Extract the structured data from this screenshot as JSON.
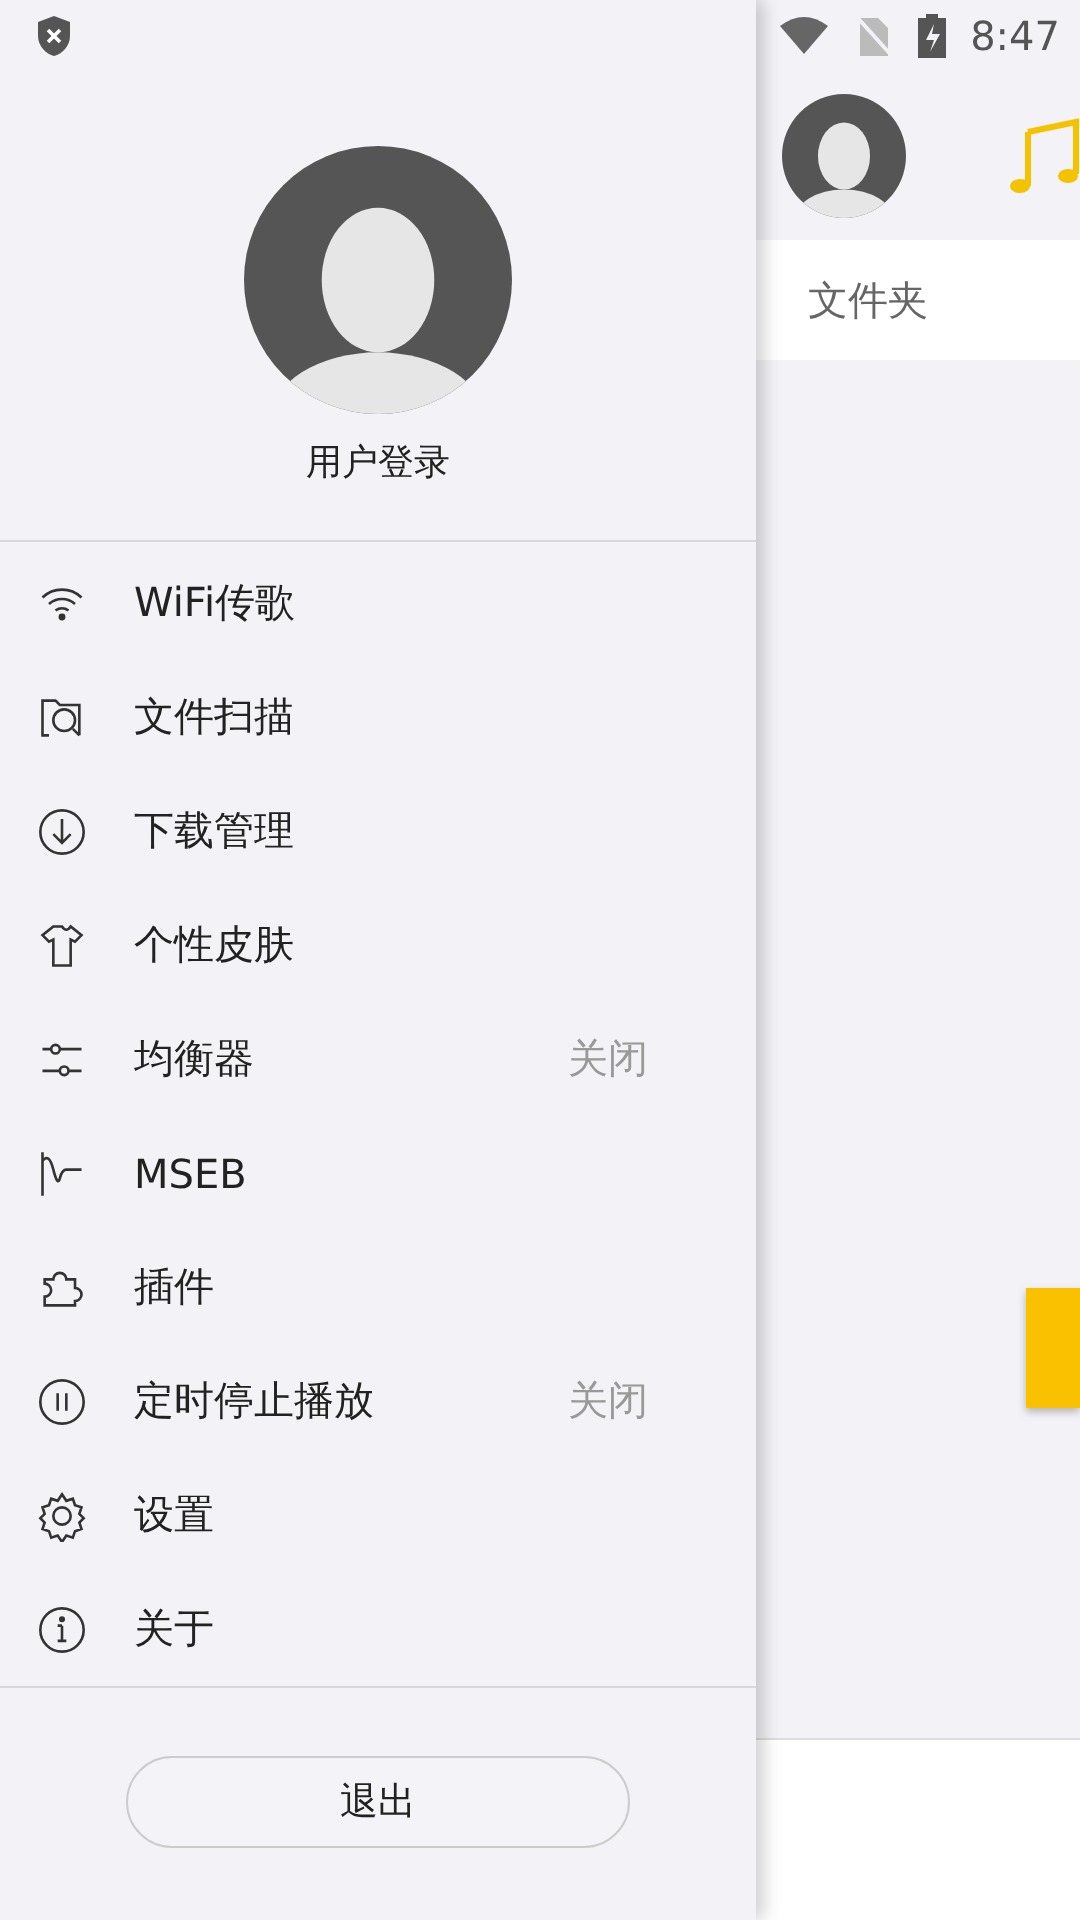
{
  "status_bar": {
    "time": "8:47"
  },
  "drawer": {
    "user": {
      "label": "用户登录"
    },
    "menu": [
      {
        "kind": "wifi",
        "label": "WiFi传歌"
      },
      {
        "kind": "scan",
        "label": "文件扫描"
      },
      {
        "kind": "download",
        "label": "下载管理"
      },
      {
        "kind": "skin",
        "label": "个性皮肤"
      },
      {
        "kind": "equalizer",
        "label": "均衡器",
        "value": "关闭"
      },
      {
        "kind": "mseb",
        "label": "MSEB"
      },
      {
        "kind": "plugin",
        "label": "插件"
      },
      {
        "kind": "timer",
        "label": "定时停止播放",
        "value": "关闭"
      },
      {
        "kind": "settings",
        "label": "设置"
      },
      {
        "kind": "about",
        "label": "关于"
      }
    ],
    "exit_button": "退出"
  },
  "main": {
    "tabs": [
      {
        "label": "文件夹"
      }
    ]
  }
}
